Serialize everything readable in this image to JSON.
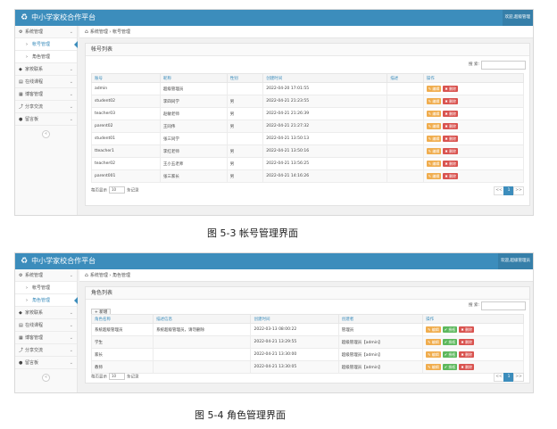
{
  "figure1": {
    "app_title": "中小学家校合作平台",
    "user_badge": "欢迎,超级管理",
    "sidebar": [
      {
        "label": "系统管理",
        "icon": "gears-icon",
        "expanded": true
      },
      {
        "label": "帐号管理",
        "sub": true,
        "active": true
      },
      {
        "label": "角色管理",
        "sub": true
      },
      {
        "label": "家校联系",
        "icon": "tag-icon"
      },
      {
        "label": "在线课程",
        "icon": "book-icon"
      },
      {
        "label": "博客管理",
        "icon": "doc-icon"
      },
      {
        "label": "分享交流",
        "icon": "share-icon"
      },
      {
        "label": "留言板",
        "icon": "comment-icon"
      }
    ],
    "breadcrumb": {
      "home": "系统管理",
      "current": "帐号管理",
      "sep": "›"
    },
    "panel_title": "帐号列表",
    "search_label": "搜 索:",
    "columns": [
      "账号",
      "昵称",
      "性别",
      "创建时间",
      "描述",
      "操作"
    ],
    "rows": [
      [
        "admin",
        "超级管理员",
        "",
        "2022-04-20 17:01:55",
        ""
      ],
      [
        "student02",
        "李四同学",
        "男",
        "2022-04-21 21:23:55",
        ""
      ],
      [
        "teacher03",
        "赵敏老师",
        "男",
        "2022-04-21 21:26:39",
        ""
      ],
      [
        "parent02",
        "王同伟",
        "男",
        "2022-04-21 21:27:32",
        ""
      ],
      [
        "student01",
        "张三同学",
        "",
        "2022-04-21 13:50:13",
        ""
      ],
      [
        "tteacher1",
        "李红老师",
        "男",
        "2022-04-21 13:50:16",
        ""
      ],
      [
        "teacher02",
        "王小五老师",
        "男",
        "2022-04-21 13:56:25",
        ""
      ],
      [
        "parent001",
        "张三家长",
        "男",
        "2022-04-21 14:16:26",
        ""
      ]
    ],
    "edit_label": "✎ 编辑",
    "delete_label": "✖ 删除",
    "footer": {
      "prefix": "每页显示",
      "page_size": "10",
      "suffix": "条记录"
    },
    "pager": [
      "<<",
      "1",
      ">>"
    ],
    "caption": "图 5-3 帐号管理界面"
  },
  "figure2": {
    "app_title": "中小学家校合作平台",
    "user_badge": "欢迎,超级管理员",
    "sidebar": [
      {
        "label": "系统管理",
        "icon": "gears-icon",
        "expanded": true
      },
      {
        "label": "帐号管理",
        "sub": true
      },
      {
        "label": "角色管理",
        "sub": true,
        "active": true
      },
      {
        "label": "家校联系",
        "icon": "tag-icon"
      },
      {
        "label": "在线课程",
        "icon": "book-icon"
      },
      {
        "label": "博客管理",
        "icon": "doc-icon"
      },
      {
        "label": "分享交流",
        "icon": "share-icon"
      },
      {
        "label": "留言板",
        "icon": "comment-icon"
      }
    ],
    "breadcrumb": {
      "home": "系统管理",
      "current": "角色管理",
      "sep": "›"
    },
    "panel_title": "角色列表",
    "add_label": "+ 新增",
    "search_label": "搜 索:",
    "columns": [
      "角色名称",
      "描述信息",
      "创建时间",
      "创建者",
      "操作"
    ],
    "rows": [
      [
        "系统超级管理员",
        "系统超级管理员，请勿删除",
        "2022-03-13 08:00:22",
        "管理员"
      ],
      [
        "学生",
        "",
        "2022-04-21 13:29:55",
        "超级管理员【admin】"
      ],
      [
        "家长",
        "",
        "2022-04-21 13:30:00",
        "超级管理员【admin】"
      ],
      [
        "教师",
        "",
        "2022-04-21 13:30:05",
        "超级管理员【admin】"
      ]
    ],
    "edit_label": "✎ 编辑",
    "auth_label": "✔ 授权",
    "delete_label": "✖ 删除",
    "footer": {
      "prefix": "每页显示",
      "page_size": "10",
      "suffix": "条记录"
    },
    "pager": [
      "<<",
      "1",
      ">>"
    ],
    "caption": "图 5-4 角色管理界面"
  }
}
